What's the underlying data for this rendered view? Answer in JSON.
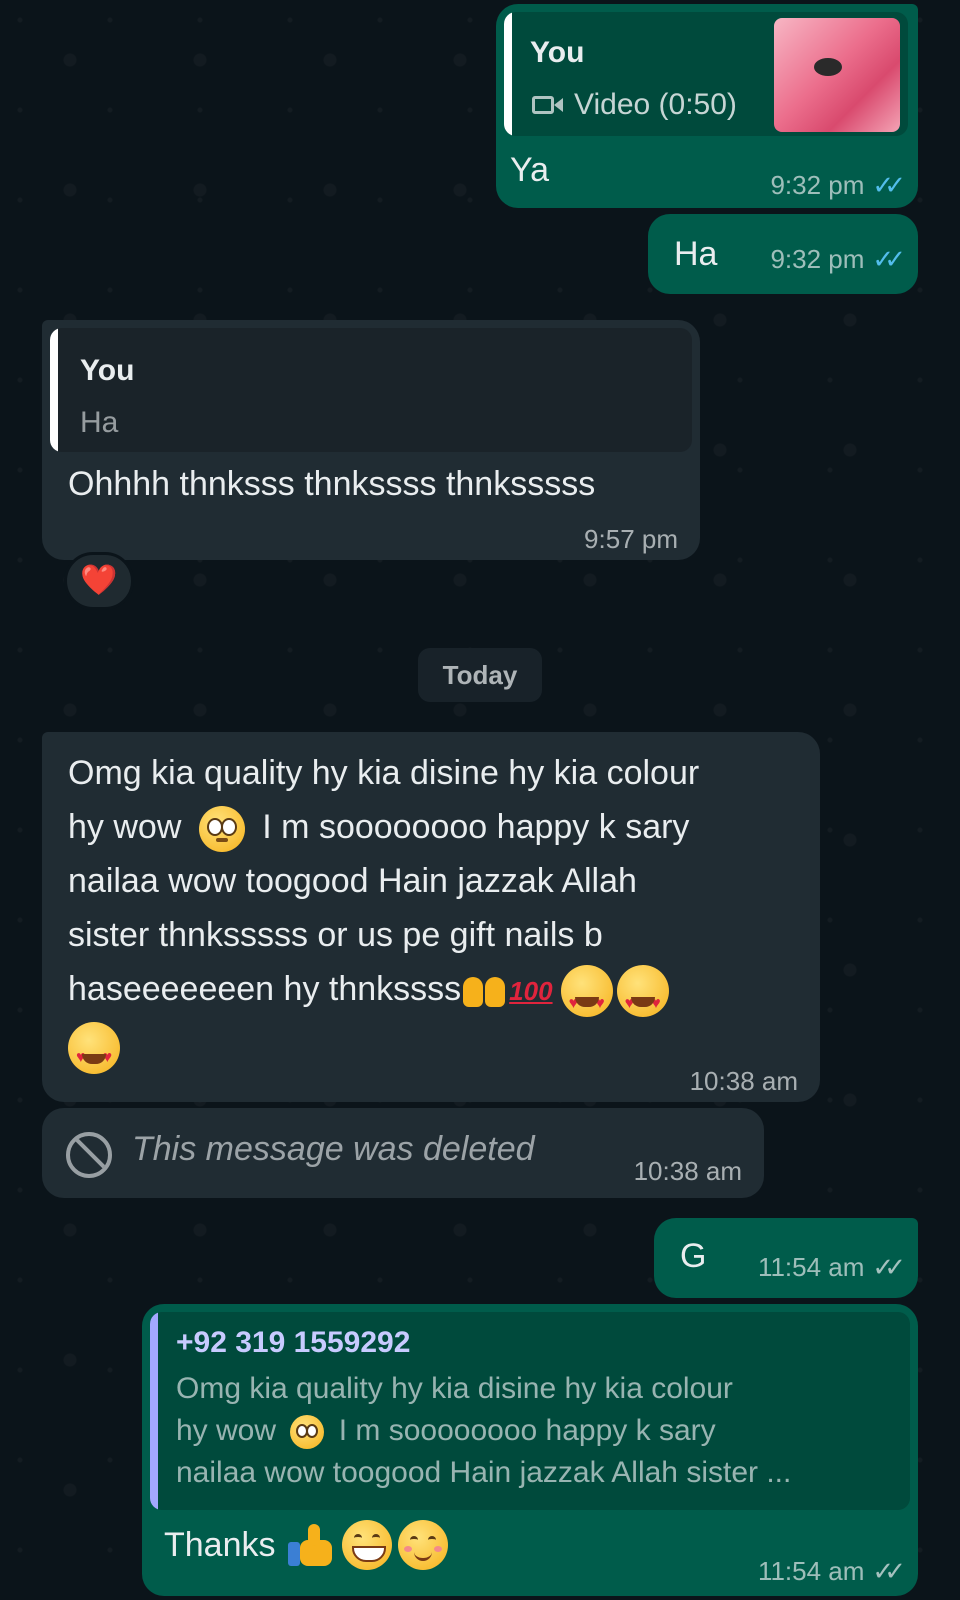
{
  "messages": [
    {
      "quote_author": "You",
      "quote_label": "Video (0:50)",
      "text": "Ya",
      "time": "9:32 pm"
    },
    {
      "text": "Ha",
      "time": "9:32 pm"
    },
    {
      "quote_author": "You",
      "quote_text": "Ha",
      "text": "Ohhhh thnksss thnkssss thnksssss",
      "time": "9:57 pm",
      "reaction": "❤️"
    },
    {
      "day_divider": "Today"
    },
    {
      "lines": [
        "Omg kia quality hy kia disine hy kia colour",
        "hy wow",
        "I m soooooooo  happy k sary",
        "nailaa wow toogood Hain jazzak Allah",
        "sister thnksssss or us pe gift nails b",
        "haseeeeeeen hy thnkssss"
      ],
      "time": "10:38 am"
    },
    {
      "text": "This message was deleted",
      "time": "10:38 am"
    },
    {
      "text": "G",
      "time": "11:54 am"
    },
    {
      "quote_author": "+92 319 1559292",
      "quote_lines": [
        "Omg kia quality hy kia disine hy kia colour",
        "hy wow",
        "I m soooooooo  happy k sary",
        "nailaa wow toogood Hain jazzak Allah sister ..."
      ],
      "text": "Thanks",
      "time": "11:54 am"
    }
  ],
  "icons": {
    "video": "video-camera-icon",
    "ban": "deleted-ban-icon",
    "read_ticks": "double-check-read-icon",
    "sent_ticks": "double-check-sent-icon"
  },
  "colors": {
    "background": "#0b141a",
    "outgoing_bubble": "#005c4b",
    "incoming_bubble": "#202c33",
    "read_tick": "#53bdeb",
    "quote_author_you": "#ffffff",
    "quote_author_contact": "#a3a8ff"
  }
}
